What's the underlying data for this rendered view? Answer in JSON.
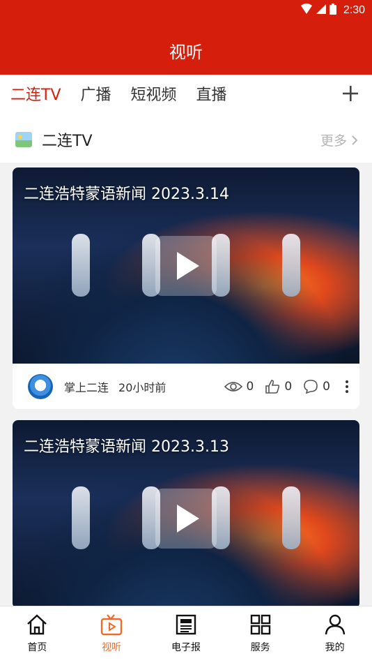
{
  "status": {
    "time": "2:30"
  },
  "header": {
    "title": "视听"
  },
  "tabs": [
    {
      "label": "二连TV",
      "active": true
    },
    {
      "label": "广播"
    },
    {
      "label": "短视频"
    },
    {
      "label": "直播"
    }
  ],
  "section": {
    "title": "二连TV",
    "more": "更多"
  },
  "videos": [
    {
      "title": "二连浩特蒙语新闻 2023.3.14",
      "source": "掌上二连",
      "time_ago": "20小时前",
      "views": "0",
      "likes": "0",
      "comments": "0"
    },
    {
      "title": "二连浩特蒙语新闻 2023.3.13"
    }
  ],
  "bottom_nav": [
    {
      "label": "首页",
      "icon": "home-icon"
    },
    {
      "label": "视听",
      "icon": "tv-icon",
      "active": true
    },
    {
      "label": "电子报",
      "icon": "newspaper-icon"
    },
    {
      "label": "服务",
      "icon": "grid-icon"
    },
    {
      "label": "我的",
      "icon": "user-icon"
    }
  ],
  "colors": {
    "brand_red": "#d61e0c",
    "active_orange": "#f26a2a"
  }
}
